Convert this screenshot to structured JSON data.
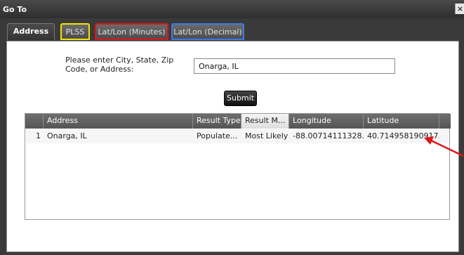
{
  "window": {
    "title": "Go To",
    "close_glyph": "×"
  },
  "tabs": [
    {
      "label": "Address",
      "active": true
    },
    {
      "label": "PLSS",
      "highlight": "#f3e600"
    },
    {
      "label": "Lat/Lon (Minutes)",
      "highlight": "#e3151a"
    },
    {
      "label": "Lat/Lon (Decimal)",
      "highlight": "#3d7ae8"
    }
  ],
  "form": {
    "prompt": "Please enter City, State, Zip Code, or Address:",
    "address_value": "Onarga, IL",
    "submit_label": "Submit"
  },
  "results": {
    "columns": [
      "",
      "Address",
      "Result Type",
      "Result M...",
      "Longitude",
      "Latitude"
    ],
    "rows": [
      [
        "1",
        "Onarga, IL",
        "Populate...",
        "Most Likely",
        "-88.00714111328...",
        "40.714958190917..."
      ]
    ]
  },
  "annotation": {
    "arrow_color": "#e3151a",
    "arrow_target": "Latitude"
  }
}
